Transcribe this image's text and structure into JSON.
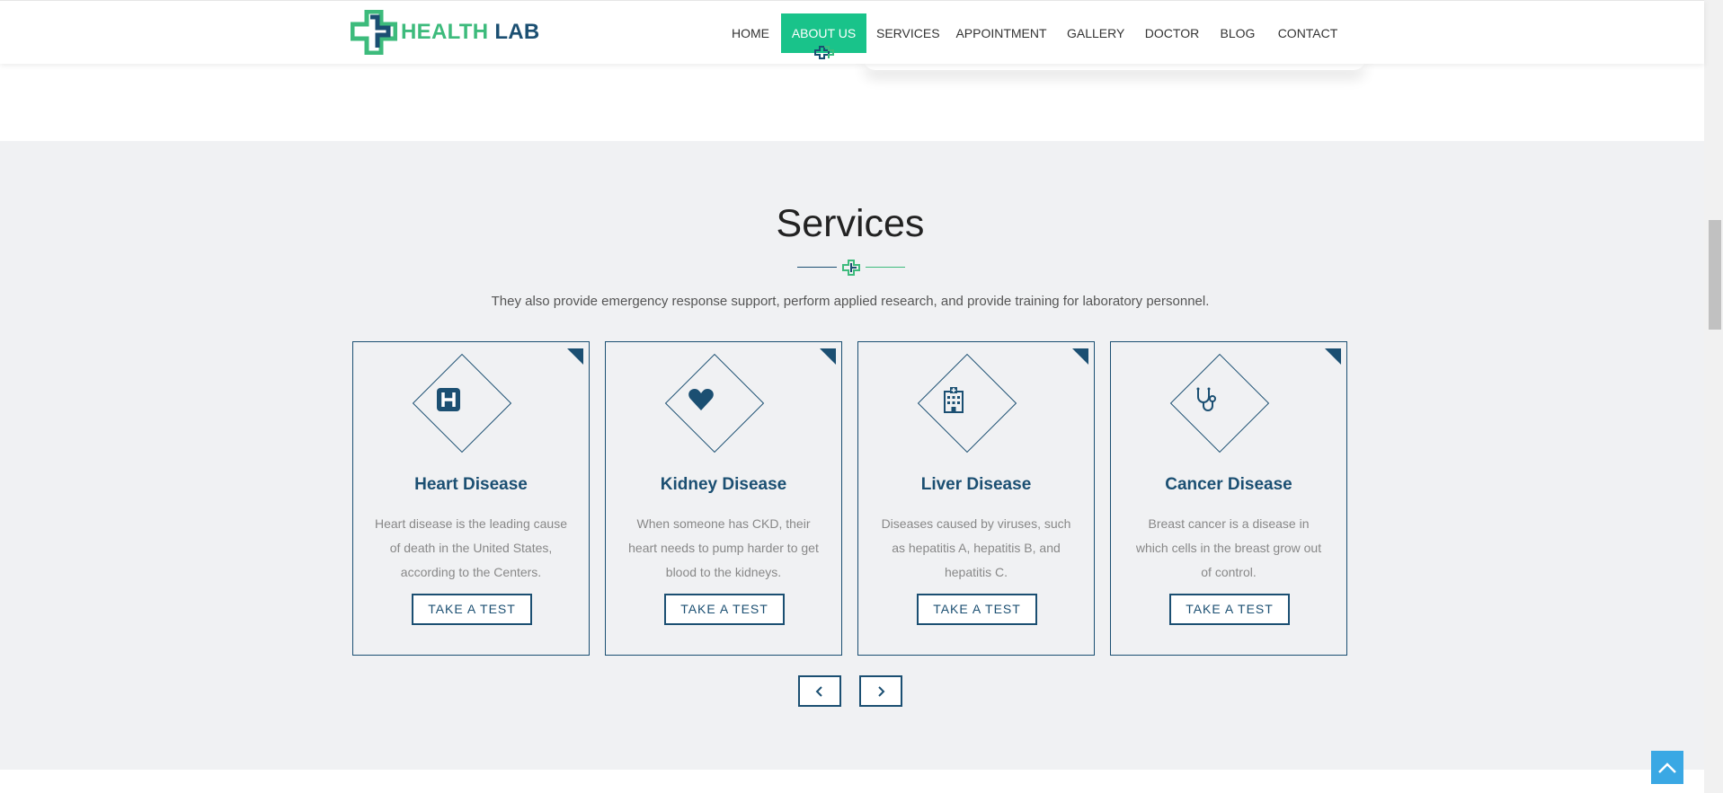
{
  "brand": {
    "logo_part1": "HEALTH",
    "logo_part2": "LAB",
    "green": "#3dbb7c",
    "navy": "#1b4f72",
    "icon": "medical-cross-logo-icon"
  },
  "nav": {
    "items": [
      "HOME",
      "ABOUT US",
      "SERVICES",
      "APPOINTMENT",
      "GALLERY",
      "DOCTOR",
      "BLOG",
      "CONTACT"
    ],
    "active": "ABOUT US",
    "active_color": "#19c38a"
  },
  "services": {
    "title": "Services",
    "subtitle": "They also provide emergency response support, perform applied research, and provide training for laboratory personnel.",
    "cards": [
      {
        "title": "Heart Disease",
        "description": "Heart disease is the leading cause of death in the United States, according to the Centers.",
        "button": "TAKE A TEST",
        "icon": "hospital-h-icon"
      },
      {
        "title": "Kidney Disease",
        "description": "When someone has CKD, their heart needs to pump harder to get blood to the kidneys.",
        "button": "TAKE A TEST",
        "icon": "heart-icon"
      },
      {
        "title": "Liver Disease",
        "description": "Diseases caused by viruses, such as hepatitis A, hepatitis B, and hepatitis C.",
        "button": "TAKE A TEST",
        "icon": "hospital-building-icon"
      },
      {
        "title": "Cancer Disease",
        "description": "Breast cancer is a disease in which cells in the breast grow out of control.",
        "button": "TAKE A TEST",
        "icon": "stethoscope-icon"
      }
    ],
    "prev_icon": "chevron-left-icon",
    "next_icon": "chevron-right-icon"
  },
  "back_to_top": {
    "icon": "chevron-up-icon",
    "color": "#3aa8e4"
  }
}
